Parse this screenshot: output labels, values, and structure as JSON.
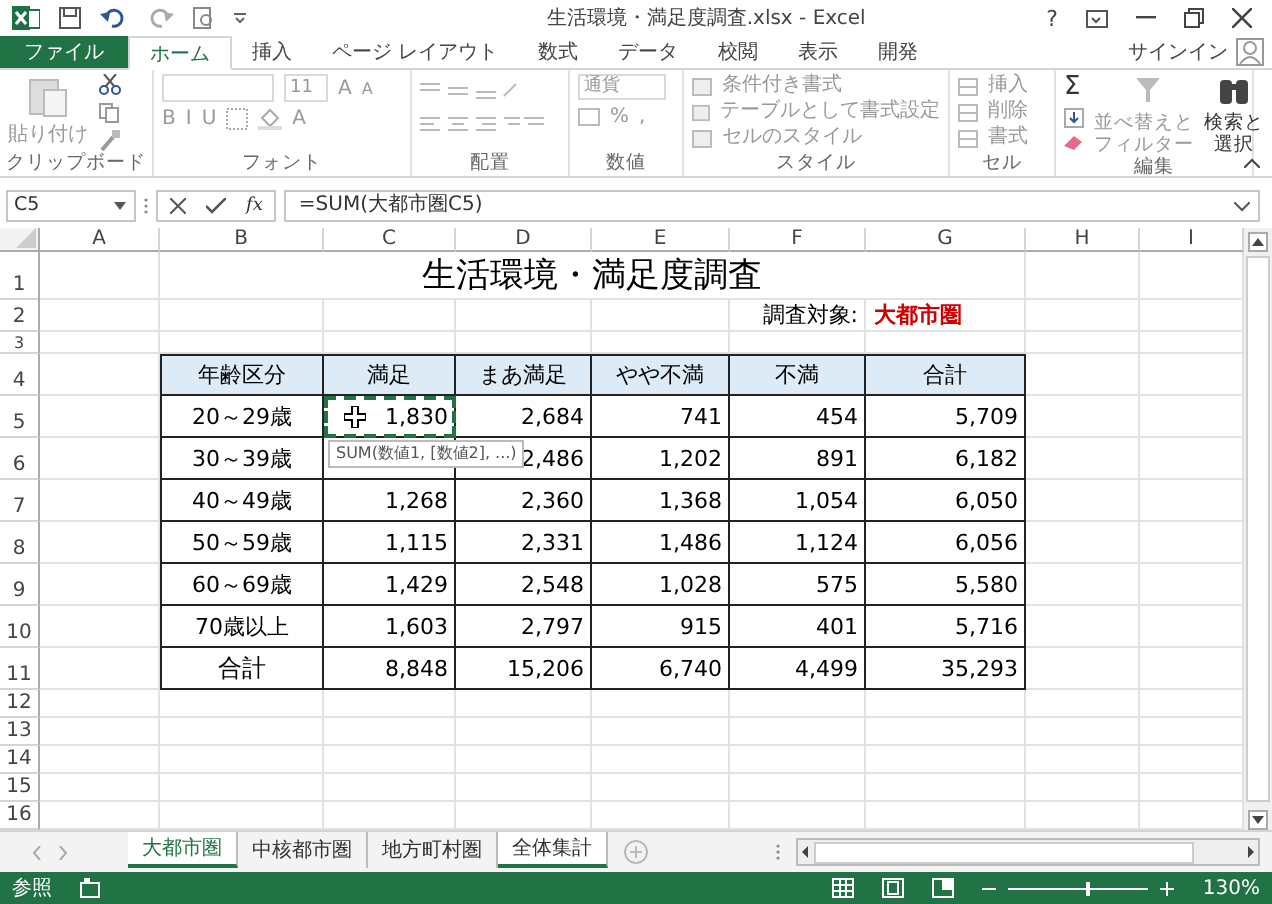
{
  "window": {
    "title": "生活環境・満足度調査.xlsx - Excel",
    "help": "?",
    "sign_in": "サインイン"
  },
  "ribbon_tabs": [
    {
      "label": "ファイル",
      "kind": "file",
      "selected": false
    },
    {
      "label": "ホーム",
      "kind": "tab",
      "selected": true
    },
    {
      "label": "挿入",
      "kind": "tab",
      "selected": false
    },
    {
      "label": "ページ レイアウト",
      "kind": "tab",
      "selected": false
    },
    {
      "label": "数式",
      "kind": "tab",
      "selected": false
    },
    {
      "label": "データ",
      "kind": "tab",
      "selected": false
    },
    {
      "label": "校閲",
      "kind": "tab",
      "selected": false
    },
    {
      "label": "表示",
      "kind": "tab",
      "selected": false
    },
    {
      "label": "開発",
      "kind": "tab",
      "selected": false
    }
  ],
  "ribbon": {
    "clipboard": {
      "name": "クリップボード",
      "paste": "貼り付け"
    },
    "font": {
      "name": "フォント",
      "size": "11",
      "grow": "A",
      "shrink": "A",
      "styles": [
        "B",
        "I",
        "U"
      ],
      "color_letter": "A"
    },
    "alignment": {
      "name": "配置"
    },
    "number": {
      "name": "数値",
      "format": "通貨",
      "percent": "%",
      "comma": ","
    },
    "styles": {
      "name": "スタイル",
      "commands": [
        "条件付き書式",
        "テーブルとして書式設定",
        "セルのスタイル"
      ]
    },
    "cells": {
      "name": "セル",
      "commands": [
        "挿入",
        "削除",
        "書式"
      ]
    },
    "editing": {
      "name": "編集",
      "sum": "Σ",
      "sort": [
        "並べ替えと",
        "フィルター"
      ],
      "find": [
        "検索と",
        "選択"
      ]
    }
  },
  "formula_bar": {
    "name_box": "C5",
    "fx": "fx",
    "formula": "=SUM(大都市圏C5)"
  },
  "sheet": {
    "columns": [
      "A",
      "B",
      "C",
      "D",
      "E",
      "F",
      "G",
      "H",
      "I"
    ],
    "row_numbers": [
      "1",
      "2",
      "3",
      "4",
      "5",
      "6",
      "7",
      "8",
      "9",
      "10",
      "11",
      "12",
      "13",
      "14",
      "15",
      "16"
    ],
    "title": "生活環境・満足度調査",
    "subject_label": "調査対象:",
    "subject_value": "大都市圏",
    "tooltip": "SUM(数値1, [数値2], ...)"
  },
  "table": {
    "columns": [
      "年齢区分",
      "満足",
      "まあ満足",
      "やや不満",
      "不満",
      "合計"
    ],
    "rows": [
      {
        "kind": "data",
        "cells": [
          {
            "text": "20～29歳",
            "selected": false
          },
          {
            "text": "1,830",
            "selected": true
          },
          {
            "text": "2,684",
            "selected": false
          },
          {
            "text": "741",
            "selected": false
          },
          {
            "text": "454",
            "selected": false
          },
          {
            "text": "5,709",
            "selected": false
          }
        ]
      },
      {
        "kind": "data",
        "cells": [
          {
            "text": "30～39歳",
            "selected": false
          },
          {
            "text": null,
            "selected": false
          },
          {
            "text": "2,486",
            "selected": false
          },
          {
            "text": "1,202",
            "selected": false
          },
          {
            "text": "891",
            "selected": false
          },
          {
            "text": "6,182",
            "selected": false
          }
        ]
      },
      {
        "kind": "data",
        "cells": [
          {
            "text": "40～49歳",
            "selected": false
          },
          {
            "text": "1,268",
            "selected": false
          },
          {
            "text": "2,360",
            "selected": false
          },
          {
            "text": "1,368",
            "selected": false
          },
          {
            "text": "1,054",
            "selected": false
          },
          {
            "text": "6,050",
            "selected": false
          }
        ]
      },
      {
        "kind": "data",
        "cells": [
          {
            "text": "50～59歳",
            "selected": false
          },
          {
            "text": "1,115",
            "selected": false
          },
          {
            "text": "2,331",
            "selected": false
          },
          {
            "text": "1,486",
            "selected": false
          },
          {
            "text": "1,124",
            "selected": false
          },
          {
            "text": "6,056",
            "selected": false
          }
        ]
      },
      {
        "kind": "data",
        "cells": [
          {
            "text": "60～69歳",
            "selected": false
          },
          {
            "text": "1,429",
            "selected": false
          },
          {
            "text": "2,548",
            "selected": false
          },
          {
            "text": "1,028",
            "selected": false
          },
          {
            "text": "575",
            "selected": false
          },
          {
            "text": "5,580",
            "selected": false
          }
        ]
      },
      {
        "kind": "data",
        "cells": [
          {
            "text": "70歳以上",
            "selected": false
          },
          {
            "text": "1,603",
            "selected": false
          },
          {
            "text": "2,797",
            "selected": false
          },
          {
            "text": "915",
            "selected": false
          },
          {
            "text": "401",
            "selected": false
          },
          {
            "text": "5,716",
            "selected": false
          }
        ]
      },
      {
        "kind": "total",
        "cells": [
          {
            "text": "合計",
            "selected": false
          },
          {
            "text": "8,848",
            "selected": false
          },
          {
            "text": "15,206",
            "selected": false
          },
          {
            "text": "6,740",
            "selected": false
          },
          {
            "text": "4,499",
            "selected": false
          },
          {
            "text": "35,293",
            "selected": false
          }
        ]
      }
    ]
  },
  "sheet_tabs": [
    {
      "label": "大都市圏",
      "selected": true,
      "active": true
    },
    {
      "label": "中核都市圏",
      "selected": false,
      "active": false
    },
    {
      "label": "地方町村圏",
      "selected": false,
      "active": false
    },
    {
      "label": "全体集計",
      "selected": true,
      "active": false
    }
  ],
  "status_bar": {
    "mode": "参照",
    "zoom": {
      "level": 0.55,
      "reading": "130%"
    }
  }
}
